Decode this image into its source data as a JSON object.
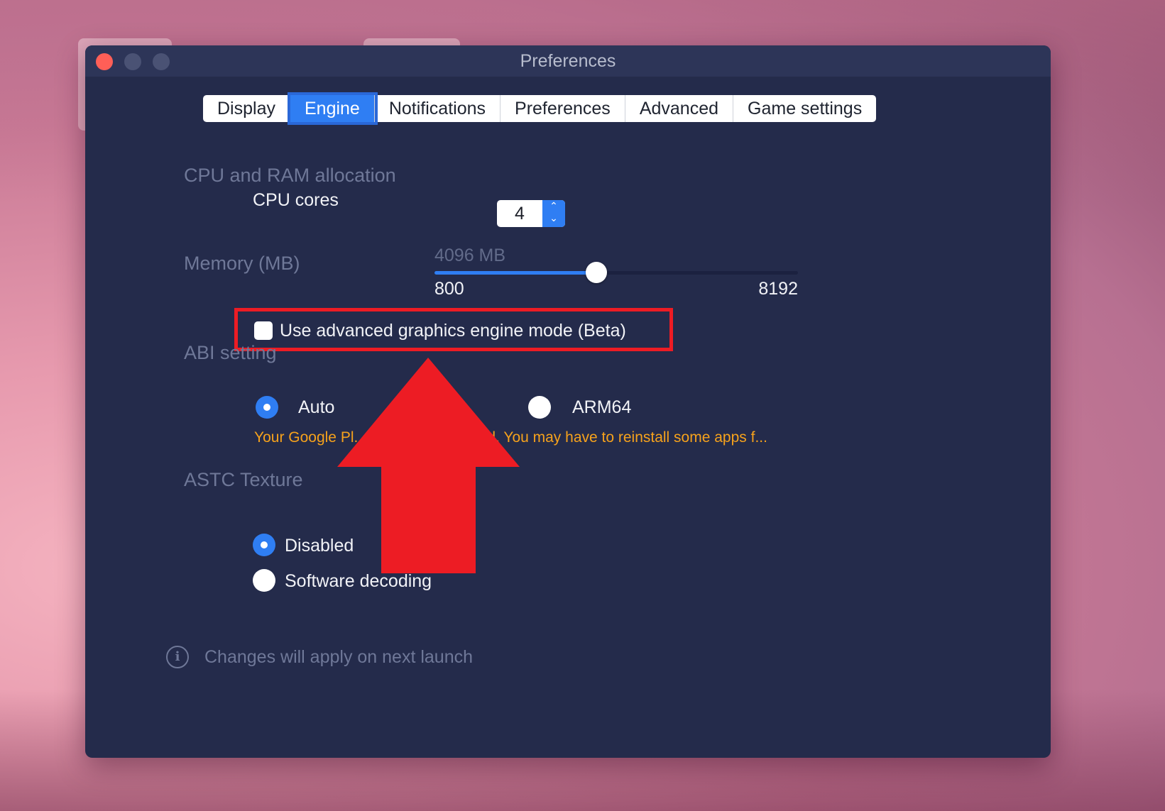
{
  "window": {
    "title": "Preferences"
  },
  "tabs": [
    {
      "label": "Display",
      "active": false
    },
    {
      "label": "Engine",
      "active": true
    },
    {
      "label": "Notifications",
      "active": false
    },
    {
      "label": "Preferences",
      "active": false
    },
    {
      "label": "Advanced",
      "active": false
    },
    {
      "label": "Game settings",
      "active": false
    }
  ],
  "cpu_ram": {
    "section_title": "CPU and RAM allocation",
    "cpu_label": "CPU cores",
    "cpu_value": "4",
    "memory_label": "Memory (MB)",
    "memory_value_text": "4096 MB",
    "memory_min": "800",
    "memory_max": "8192",
    "memory_value": 4096
  },
  "graphics": {
    "checkbox_label": "Use advanced graphics engine mode (Beta)",
    "checked": false
  },
  "abi": {
    "section_title": "ABI setting",
    "options": [
      {
        "label": "Auto",
        "selected": true
      },
      {
        "label": "ARM64",
        "selected": false
      }
    ],
    "warning": "Your Google Pl... vice will be cleared. You may have to reinstall some apps f..."
  },
  "astc": {
    "section_title": "ASTC Texture",
    "options": [
      {
        "label": "Disabled",
        "selected": true
      },
      {
        "label": "Software decoding",
        "selected": false
      }
    ]
  },
  "footer": {
    "text": "Changes will apply on next launch"
  },
  "colors": {
    "accent": "#2f7ef3",
    "window_bg": "#242b4b",
    "highlight": "#ed1c24",
    "warning": "#f6a21c"
  }
}
